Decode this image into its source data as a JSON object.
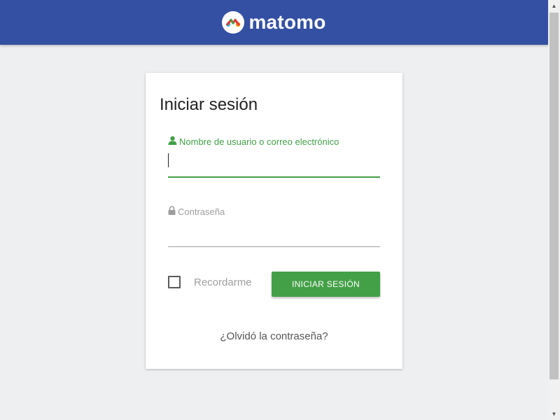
{
  "header": {
    "brand": "matomo",
    "bg_color": "#3450a3"
  },
  "login": {
    "title": "Iniciar sesión",
    "username": {
      "label": "Nombre de usuario o correo electrónico",
      "value": "",
      "icon": "user-icon"
    },
    "password": {
      "label": "Contraseña",
      "value": "",
      "icon": "lock-icon"
    },
    "remember_label": "Recordarme",
    "submit_label": "INICIAR SESIÓN",
    "forgot_label": "¿Olvidó la contraseña?"
  },
  "colors": {
    "accent": "#43a047",
    "muted": "#9e9e9e"
  }
}
